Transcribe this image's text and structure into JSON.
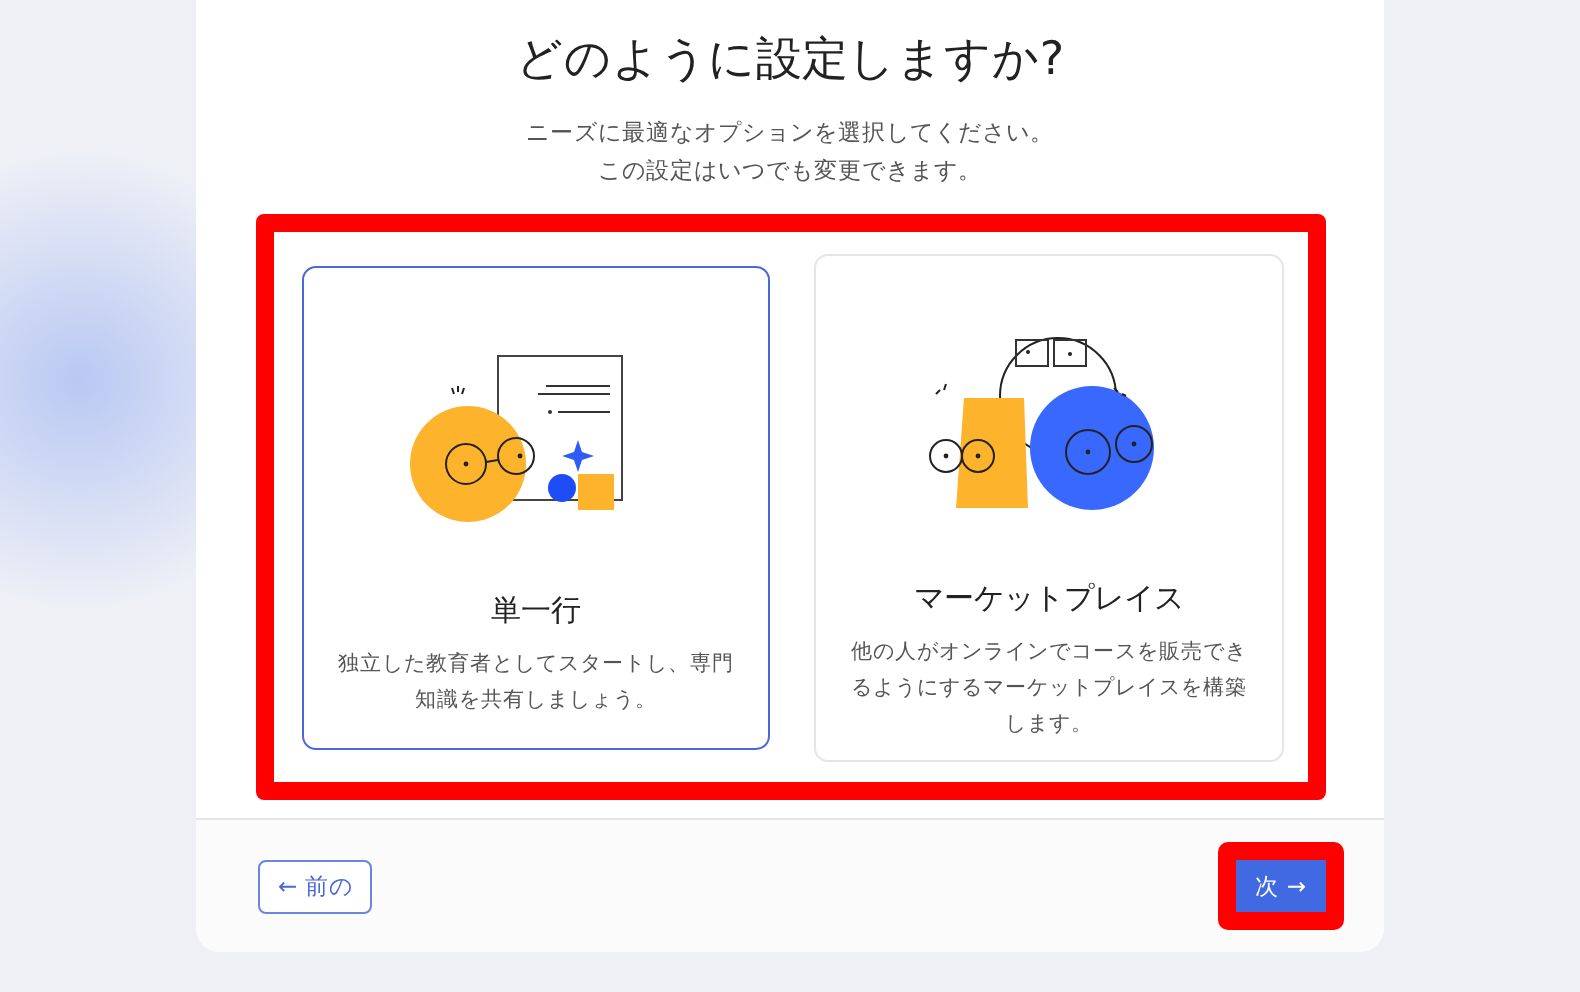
{
  "title": "どのように設定しますか?",
  "subtitle": "ニーズに最適なオプションを選択してください。この設定はいつでも変更できます。",
  "options_highlighted": true,
  "options": [
    {
      "kind": "single",
      "title": "単一行",
      "description": "独立した教育者としてスタートし、専門知識を共有しましょう。",
      "selected": true
    },
    {
      "kind": "marketplace",
      "title": "マーケットプレイス",
      "description": "他の人がオンラインでコースを販売できるようにするマーケットプレイスを構築します。",
      "selected": false
    }
  ],
  "footer": {
    "back_button": "← 前の",
    "next_button": "次 →",
    "next_highlighted": true
  }
}
